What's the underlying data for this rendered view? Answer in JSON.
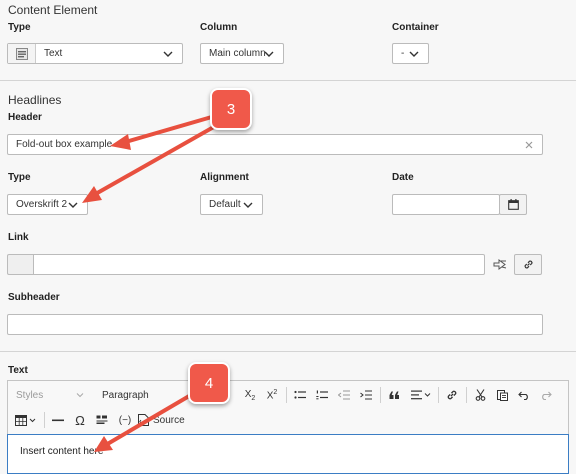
{
  "content_element": {
    "title": "Content Element",
    "type_label": "Type",
    "type_value": "Text",
    "column_label": "Column",
    "column_value": "Main column",
    "container_label": "Container",
    "container_value": "-"
  },
  "headlines": {
    "title": "Headlines",
    "header_label": "Header",
    "header_value": "Fold-out box example",
    "type_label": "Type",
    "type_value": "Overskrift 2",
    "alignment_label": "Alignment",
    "alignment_value": "Default",
    "date_label": "Date",
    "date_value": "",
    "link_label": "Link",
    "link_value": "",
    "subheader_label": "Subheader",
    "subheader_value": ""
  },
  "text": {
    "label": "Text",
    "styles_label": "Styles",
    "paragraph_label": "Paragraph",
    "source_label": "Source",
    "content": "Insert content here"
  },
  "callouts": [
    {
      "number": "3"
    },
    {
      "number": "4"
    }
  ],
  "colors": {
    "callout": "#f0594a",
    "arrow": "#e8503f"
  }
}
